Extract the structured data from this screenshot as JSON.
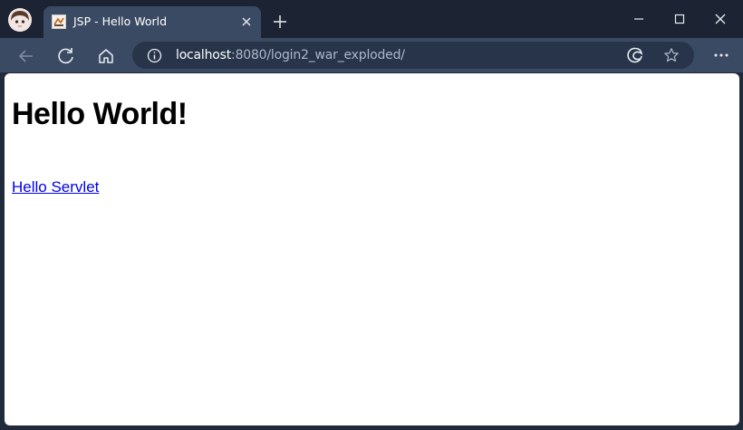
{
  "browser": {
    "tab": {
      "title": "JSP - Hello World",
      "favicon": "jsp-favicon-icon"
    },
    "address_bar": {
      "host": "localhost",
      "rest": ":8080/login2_war_exploded/"
    },
    "icons": {
      "profile": "profile-avatar-icon",
      "back": "back-arrow-icon",
      "reload": "reload-icon",
      "home": "home-icon",
      "info": "info-icon",
      "edge": "edge-icon",
      "favorite": "star-icon",
      "menu": "more-icon",
      "new_tab": "plus-icon",
      "close_tab": "close-icon"
    },
    "colors": {
      "titlebar": "#1c2433",
      "toolbar": "#3b4a63",
      "address_bg": "#27344a",
      "link": "#0000ee"
    }
  },
  "page": {
    "heading": "Hello World!",
    "link_text": "Hello Servlet"
  }
}
